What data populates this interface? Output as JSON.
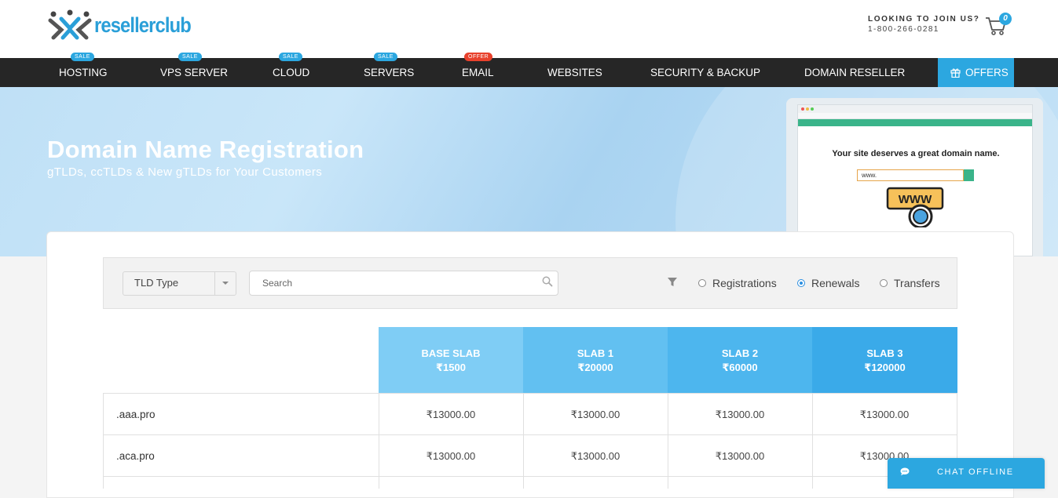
{
  "header": {
    "brand": "resellerclub",
    "join_label": "LOOKING TO JOIN US?",
    "phone": "1-800-266-0281",
    "cart_count": "0",
    "accent_color": "#2ca7e0"
  },
  "nav": {
    "items": [
      {
        "label": "HOSTING",
        "badge": "SALE"
      },
      {
        "label": "VPS SERVER",
        "badge": "SALE"
      },
      {
        "label": "CLOUD",
        "badge": "SALE"
      },
      {
        "label": "SERVERS",
        "badge": "SALE"
      },
      {
        "label": "EMAIL",
        "badge": "OFFER"
      },
      {
        "label": "WEBSITES",
        "badge": ""
      },
      {
        "label": "SECURITY & BACKUP",
        "badge": ""
      },
      {
        "label": "DOMAIN RESELLER",
        "badge": ""
      }
    ],
    "offers_label": "OFFERS"
  },
  "hero": {
    "title": "Domain Name Registration",
    "subtitle": "gTLDs, ccTLDs & New gTLDs for Your Customers",
    "mock_headline": "Your site deserves a great domain name.",
    "mock_input": "www.",
    "mock_badge": "WWW"
  },
  "filters": {
    "tld_type_label": "TLD Type",
    "search_placeholder": "Search",
    "radios": [
      {
        "label": "Registrations",
        "selected": false
      },
      {
        "label": "Renewals",
        "selected": true
      },
      {
        "label": "Transfers",
        "selected": false
      }
    ]
  },
  "table": {
    "columns": [
      {
        "name": "BASE SLAB",
        "amount": "₹1500",
        "color": "#7fcdf5"
      },
      {
        "name": "SLAB 1",
        "amount": "₹20000",
        "color": "#62c0f1"
      },
      {
        "name": "SLAB 2",
        "amount": "₹60000",
        "color": "#4db6ee"
      },
      {
        "name": "SLAB 3",
        "amount": "₹120000",
        "color": "#3aaae9"
      }
    ],
    "rows": [
      {
        "tld": ".aaa.pro",
        "prices": [
          "₹13000.00",
          "₹13000.00",
          "₹13000.00",
          "₹13000.00"
        ]
      },
      {
        "tld": ".aca.pro",
        "prices": [
          "₹13000.00",
          "₹13000.00",
          "₹13000.00",
          "₹13000.00"
        ]
      }
    ]
  },
  "chat": {
    "label": "CHAT OFFLINE"
  }
}
